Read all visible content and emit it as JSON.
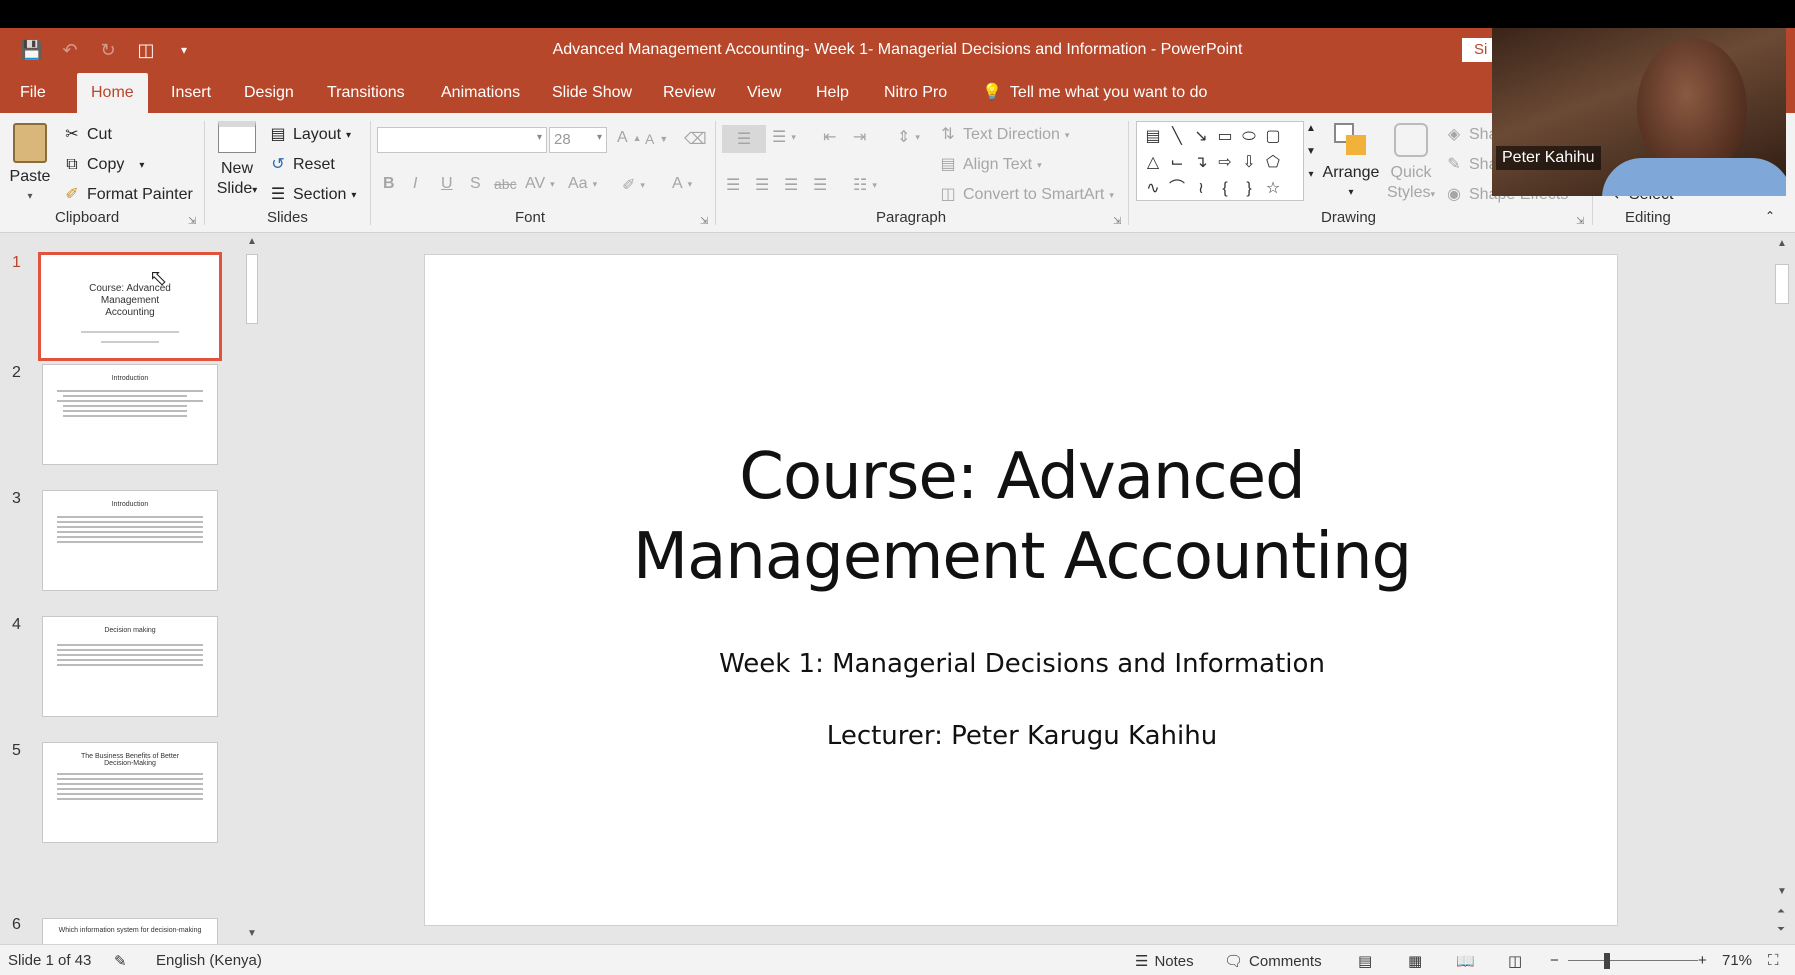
{
  "window": {
    "title": "Advanced Management Accounting- Week 1-  Managerial Decisions and Information  -  PowerPoint",
    "signin_label": "Si"
  },
  "tabs": [
    "File",
    "Home",
    "Insert",
    "Design",
    "Transitions",
    "Animations",
    "Slide Show",
    "Review",
    "View",
    "Help",
    "Nitro Pro"
  ],
  "tell_me": "Tell me what you want to do",
  "ribbon": {
    "clipboard": {
      "paste": "Paste",
      "cut": "Cut",
      "copy": "Copy",
      "format_painter": "Format Painter",
      "label": "Clipboard"
    },
    "slides": {
      "new_slide_1": "New",
      "new_slide_2": "Slide",
      "layout": "Layout",
      "reset": "Reset",
      "section": "Section",
      "label": "Slides"
    },
    "font": {
      "font_name": "",
      "font_size": "28",
      "label": "Font",
      "bold": "B",
      "italic": "I",
      "underline": "U",
      "shadow": "S",
      "strike": "abc",
      "spacing": "AV",
      "case": "Aa",
      "color": "A"
    },
    "paragraph": {
      "text_direction": "Text Direction",
      "align_text": "Align Text",
      "convert_smartart": "Convert to SmartArt",
      "label": "Paragraph"
    },
    "drawing": {
      "arrange": "Arrange",
      "quick_styles_1": "Quick",
      "quick_styles_2": "Styles",
      "shape_fill": "Sha",
      "shape_outline": "Sha",
      "shape_effects": "Shape Effects",
      "label": "Drawing"
    },
    "editing": {
      "select": "Select",
      "label": "Editing"
    }
  },
  "thumbnails": [
    {
      "num": "1",
      "title": "Course: Advanced Management Accounting"
    },
    {
      "num": "2",
      "title": "Introduction"
    },
    {
      "num": "3",
      "title": "Introduction"
    },
    {
      "num": "4",
      "title": "Decision making"
    },
    {
      "num": "5",
      "title": "The Business Benefits of Better Decision-Making"
    },
    {
      "num": "6",
      "title": "Which information system for decision-making"
    }
  ],
  "slide": {
    "title_line1": "Course: Advanced",
    "title_line2": "Management Accounting",
    "subtitle": "Week 1: Managerial Decisions and Information",
    "lecturer": "Lecturer: Peter Karugu Kahihu"
  },
  "status": {
    "slide_count": "Slide 1 of 43",
    "language": "English (Kenya)",
    "notes": "Notes",
    "comments": "Comments",
    "zoom": "71%"
  },
  "webcam": {
    "name": "Peter Kahihu"
  },
  "colors": {
    "accent": "#b7472a",
    "ribbon_bg": "#f3f3f3",
    "workspace": "#e6e6e6",
    "selection": "#e0533c"
  }
}
